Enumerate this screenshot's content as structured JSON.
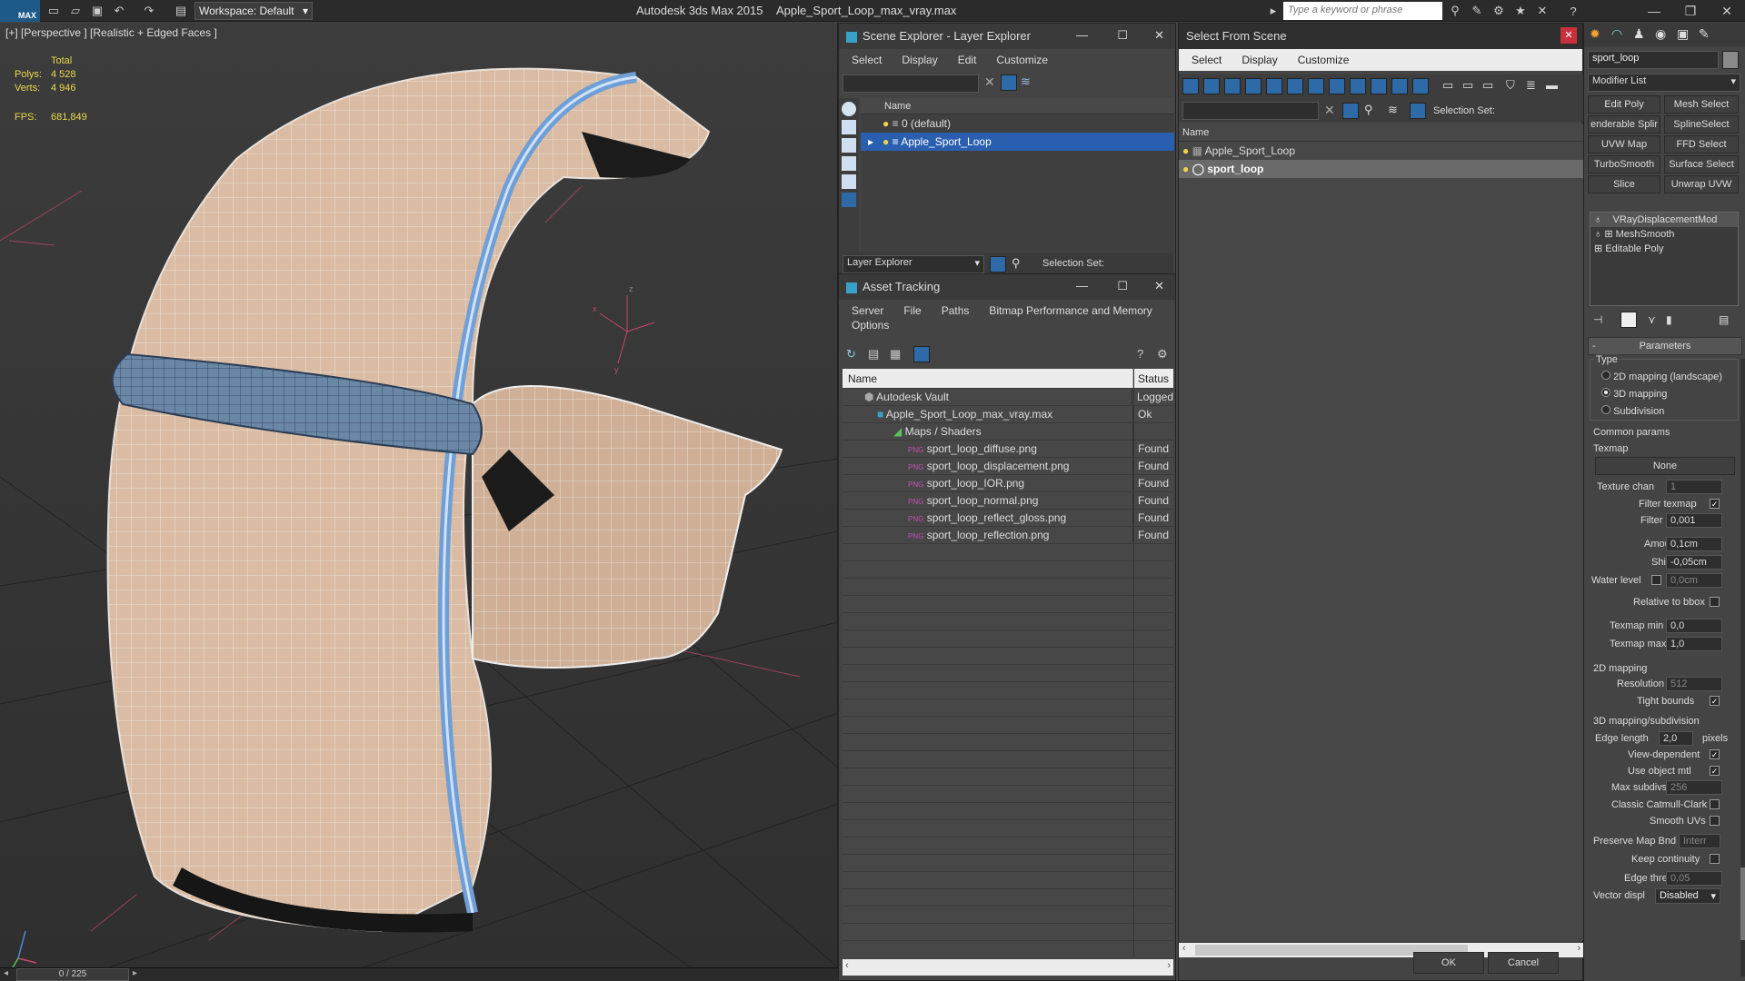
{
  "titlebar": {
    "logo": "MAX",
    "workspace": "Workspace: Default",
    "app": "Autodesk 3ds Max  2015",
    "file": "Apple_Sport_Loop_max_vray.max",
    "search_placeholder": "Type a keyword or phrase"
  },
  "viewport": {
    "label": "[+] [Perspective ] [Realistic + Edged Faces ]",
    "total_label": "Total",
    "polys_label": "Polys:",
    "polys": "4 528",
    "verts_label": "Verts:",
    "verts": "4 946",
    "fps_label": "FPS:",
    "fps": "681,849",
    "axis_x": "x",
    "axis_y": "y",
    "axis_z": "z"
  },
  "timeline": {
    "frame": "0 / 225"
  },
  "scene_explorer": {
    "title": "Scene Explorer - Layer Explorer",
    "menu": [
      "Select",
      "Display",
      "Edit",
      "Customize"
    ],
    "col_name": "Name",
    "rows": [
      "0 (default)",
      "Apple_Sport_Loop"
    ],
    "footer_label": "Layer Explorer",
    "selection_set": "Selection Set:"
  },
  "asset_tracking": {
    "title": "Asset Tracking",
    "menu": [
      "Server",
      "File",
      "Paths",
      "Bitmap Performance and Memory"
    ],
    "menu2": "Options",
    "col_name": "Name",
    "col_status": "Status",
    "rows": [
      {
        "name": "Autodesk Vault",
        "status": "Logged"
      },
      {
        "name": "Apple_Sport_Loop_max_vray.max",
        "status": "Ok"
      },
      {
        "name": "Maps / Shaders",
        "status": ""
      },
      {
        "name": "sport_loop_diffuse.png",
        "status": "Found"
      },
      {
        "name": "sport_loop_displacement.png",
        "status": "Found"
      },
      {
        "name": "sport_loop_IOR.png",
        "status": "Found"
      },
      {
        "name": "sport_loop_normal.png",
        "status": "Found"
      },
      {
        "name": "sport_loop_reflect_gloss.png",
        "status": "Found"
      },
      {
        "name": "sport_loop_reflection.png",
        "status": "Found"
      }
    ],
    "png": "PNG"
  },
  "select_from_scene": {
    "title": "Select From Scene",
    "menu": [
      "Select",
      "Display",
      "Customize"
    ],
    "selection_set": "Selection Set:",
    "col_name": "Name",
    "rows": [
      "Apple_Sport_Loop",
      "sport_loop"
    ],
    "ok": "OK",
    "cancel": "Cancel"
  },
  "command_panel": {
    "object_name": "sport_loop",
    "modifier_list": "Modifier List",
    "buttons": [
      "Edit Poly",
      "Mesh Select",
      "enderable Splir",
      "SplineSelect",
      "UVW Map",
      "FFD Select",
      "TurboSmooth",
      "Surface Select",
      "Slice",
      "Unwrap UVW"
    ],
    "stack": [
      "VRayDisplacementMod",
      "MeshSmooth",
      "Editable Poly"
    ],
    "rollout": "Parameters",
    "type_label": "Type",
    "types": [
      "2D mapping (landscape)",
      "3D mapping",
      "Subdivision"
    ],
    "common_params": "Common params",
    "texmap": "Texmap",
    "texmap_value": "None",
    "texture_chan": "Texture chan",
    "texture_chan_val": "1",
    "filter_texmap": "Filter texmap",
    "filter_blur": "Filter blur",
    "filter_blur_val": "0,001",
    "amount": "Amount",
    "amount_val": "0,1cm",
    "shift": "Shift",
    "shift_val": "-0,05cm",
    "water_level": "Water level",
    "water_level_val": "0,0cm",
    "relative_bbox": "Relative to bbox",
    "texmap_min": "Texmap min",
    "texmap_min_val": "0,0",
    "texmap_max": "Texmap max",
    "texmap_max_val": "1,0",
    "mapping_2d": "2D mapping",
    "resolution": "Resolution",
    "resolution_val": "512",
    "tight_bounds": "Tight bounds",
    "mapping_3d": "3D mapping/subdivision",
    "edge_length": "Edge length",
    "edge_length_val": "2,0",
    "pixels": "pixels",
    "view_dependent": "View-dependent",
    "use_object_mtl": "Use object mtl",
    "max_subdivs": "Max subdivs",
    "max_subdivs_val": "256",
    "classic_catmull": "Classic Catmull-Clark",
    "smooth_uvs": "Smooth UVs",
    "preserve_map": "Preserve Map Bnd",
    "preserve_map_val": "Interr",
    "keep_continuity": "Keep continuity",
    "edge_thresh": "Edge thresh",
    "edge_thresh_val": "0,05",
    "vector_displ": "Vector displ",
    "vector_displ_val": "Disabled"
  }
}
